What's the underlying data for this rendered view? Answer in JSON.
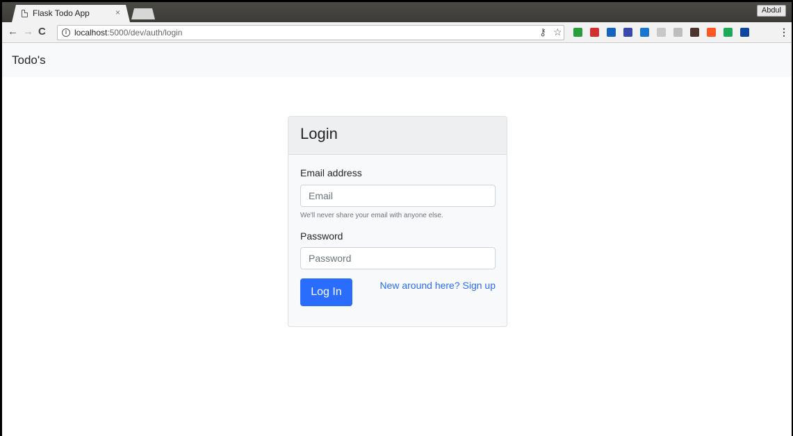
{
  "browser": {
    "tab_title": "Flask Todo App",
    "tab_close": "×",
    "profile_name": "Abdul",
    "nav": {
      "back": "←",
      "forward": "→",
      "reload": "C",
      "info": "i",
      "menu": "⋮"
    },
    "url_host": "localhost",
    "url_path": ":5000/dev/auth/login",
    "key_icon": "⚷",
    "star_icon": "☆",
    "extensions": [
      {
        "name": "ext-icon-1",
        "color": "#2a9d3d"
      },
      {
        "name": "ext-icon-2",
        "color": "#d32f2f"
      },
      {
        "name": "ext-icon-3",
        "color": "#1565c0"
      },
      {
        "name": "ext-icon-4",
        "color": "#3949ab"
      },
      {
        "name": "ext-icon-5",
        "color": "#1976d2"
      },
      {
        "name": "ext-icon-6",
        "color": "#c8c8c8"
      },
      {
        "name": "ext-icon-7",
        "color": "#bdbdbd"
      },
      {
        "name": "ext-icon-8",
        "color": "#4e342e"
      },
      {
        "name": "ext-icon-9",
        "color": "#ff5722"
      },
      {
        "name": "ext-icon-10",
        "color": "#1faa59"
      },
      {
        "name": "ext-icon-11",
        "color": "#0d47a1"
      }
    ]
  },
  "app": {
    "brand": "Todo's",
    "login": {
      "title": "Login",
      "email_label": "Email address",
      "email_placeholder": "Email",
      "email_help": "We'll never share your email with anyone else.",
      "password_label": "Password",
      "password_placeholder": "Password",
      "submit_label": "Log In",
      "signup_link": "New around here? Sign up"
    }
  },
  "colors": {
    "primary": "#2a6cfb",
    "navbar_bg": "#f8f9fa"
  }
}
